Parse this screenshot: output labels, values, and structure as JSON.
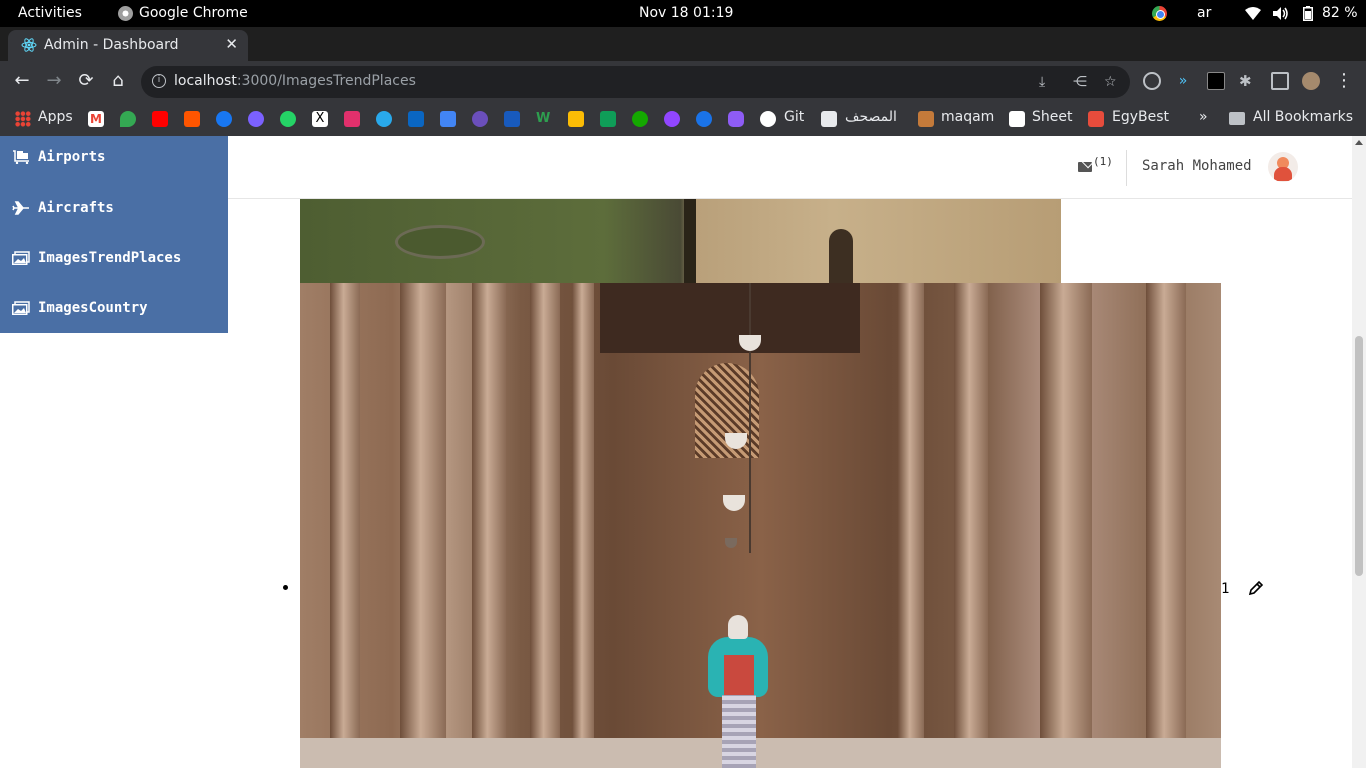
{
  "system_bar": {
    "activities": "Activities",
    "app_name": "Google Chrome",
    "clock": "Nov 18  01:19",
    "language": "ar",
    "battery": "82 %"
  },
  "browser": {
    "tab_title": "Admin - Dashboard",
    "url_host": "localhost",
    "url_rest": ":3000/ImagesTrendPlaces",
    "bookmarks": {
      "apps": "Apps",
      "git": "Git",
      "mushaf": "المصحف",
      "maqam": "maqam",
      "sheet": "Sheet",
      "egybest": "EgyBest",
      "more": "»",
      "all_bookmarks": "All Bookmarks"
    }
  },
  "sidebar": {
    "items": [
      {
        "label": "Airports",
        "icon": "luggage-cart-icon"
      },
      {
        "label": "Aircrafts",
        "icon": "plane-icon"
      },
      {
        "label": "ImagesTrendPlaces",
        "icon": "images-icon"
      },
      {
        "label": "ImagesCountry",
        "icon": "images-icon"
      }
    ]
  },
  "header": {
    "mail_count": "(1)",
    "user_name": "Sarah Mohamed"
  },
  "content": {
    "row_index": "1"
  },
  "colors": {
    "sidebar_bg": "#4a6fa5",
    "chrome_dark": "#35363a",
    "topbar": "#000000"
  }
}
